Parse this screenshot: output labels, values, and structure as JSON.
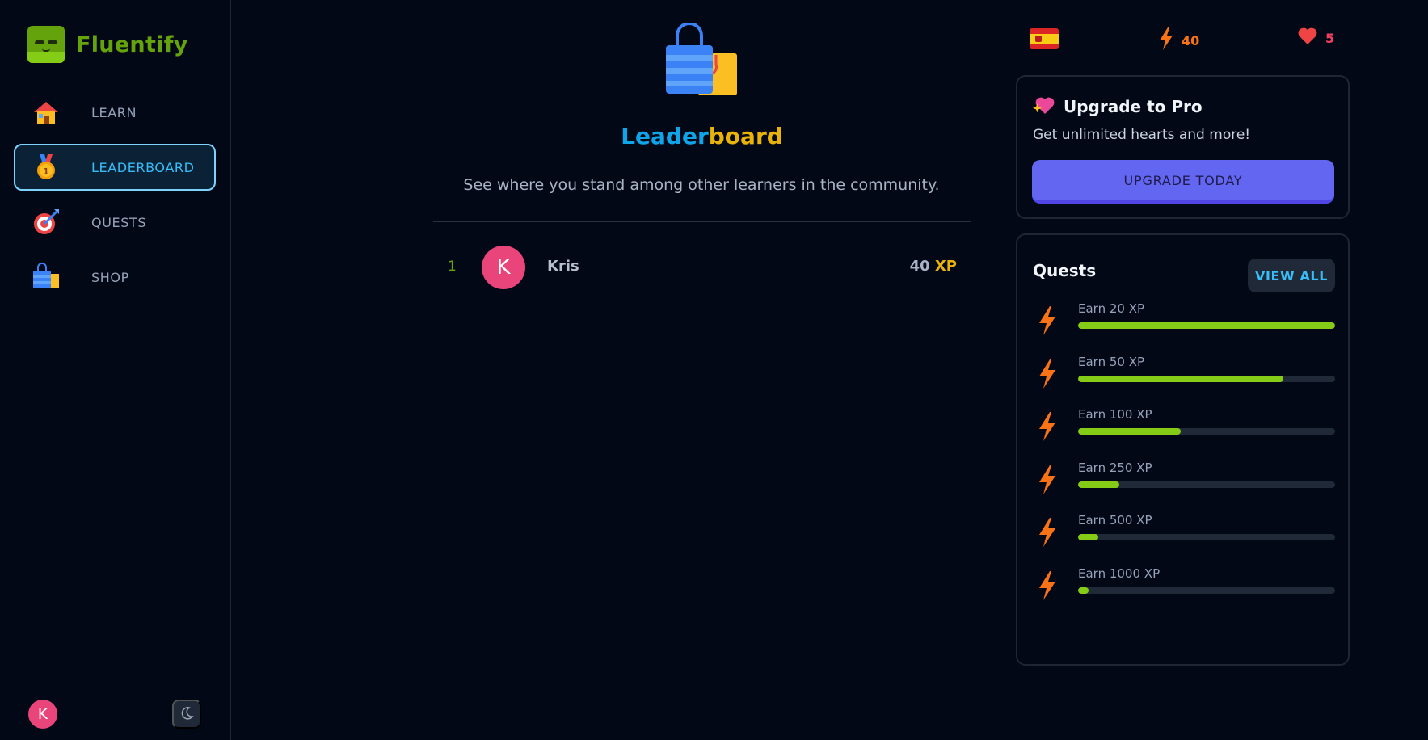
{
  "brand": {
    "name": "Fluentify"
  },
  "nav": [
    {
      "label": "LEARN",
      "icon": "house-icon",
      "active": false
    },
    {
      "label": "LEADERBOARD",
      "icon": "medal-icon",
      "active": true
    },
    {
      "label": "QUESTS",
      "icon": "target-icon",
      "active": false
    },
    {
      "label": "SHOP",
      "icon": "shopping-bag-icon",
      "active": false
    }
  ],
  "footer": {
    "avatar_initial": "K",
    "theme_icon": "moon-icon"
  },
  "page": {
    "title_part1": "Leader",
    "title_part2": "board",
    "subtitle": "See where you stand among other learners in the community."
  },
  "leaderboard": [
    {
      "rank": "1",
      "initial": "K",
      "name": "Kris",
      "xp": "40",
      "unit": "XP"
    }
  ],
  "stats": {
    "flag": "spain-flag-icon",
    "streak": "40",
    "hearts": "5"
  },
  "pro": {
    "title": "Upgrade to Pro",
    "description": "Get unlimited hearts and more!",
    "button": "UPGRADE TODAY"
  },
  "quests": {
    "title": "Quests",
    "view_all": "VIEW ALL",
    "items": [
      {
        "label": "Earn 20 XP",
        "progress": 1.0
      },
      {
        "label": "Earn 50 XP",
        "progress": 0.8
      },
      {
        "label": "Earn 100 XP",
        "progress": 0.4
      },
      {
        "label": "Earn 250 XP",
        "progress": 0.16
      },
      {
        "label": "Earn 500 XP",
        "progress": 0.08
      },
      {
        "label": "Earn 1000 XP",
        "progress": 0.04
      }
    ]
  },
  "colors": {
    "accent": "#0ea5e9",
    "gold": "#eab308",
    "brand": "#65a30d",
    "pro": "#6366f1",
    "progress": "#84cc16"
  }
}
